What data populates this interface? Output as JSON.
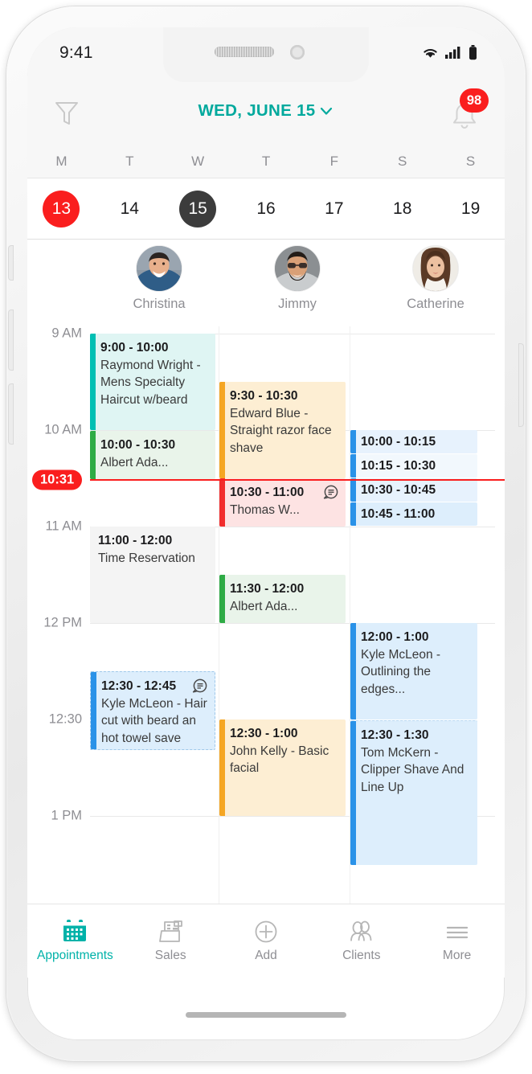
{
  "status_bar": {
    "time": "9:41",
    "wifi_icon": "wifi-icon",
    "cellular_icon": "cellular-signal-icon",
    "battery_icon": "battery-icon"
  },
  "header": {
    "filter_icon": "filter-funnel-icon",
    "date_title": "WED, JUNE 15",
    "chevron_icon": "chevron-down-icon",
    "bell_icon": "notification-bell-icon",
    "badge_count": "98"
  },
  "week": {
    "day_initials": [
      "M",
      "T",
      "W",
      "T",
      "F",
      "S",
      "S"
    ],
    "dates": [
      {
        "num": "13",
        "state": "today"
      },
      {
        "num": "14",
        "state": "normal"
      },
      {
        "num": "15",
        "state": "selected"
      },
      {
        "num": "16",
        "state": "normal"
      },
      {
        "num": "17",
        "state": "normal"
      },
      {
        "num": "18",
        "state": "normal"
      },
      {
        "num": "19",
        "state": "normal"
      }
    ]
  },
  "staff": [
    {
      "name": "Christina",
      "avatar": "avatar-christina"
    },
    {
      "name": "Jimmy",
      "avatar": "avatar-jimmy"
    },
    {
      "name": "Catherine",
      "avatar": "avatar-catherine"
    }
  ],
  "calendar": {
    "time_labels": [
      "9 AM",
      "10 AM",
      "11 AM",
      "12 PM",
      "12:30",
      "1 PM"
    ],
    "now_indicator": {
      "label": "10:31",
      "color": "#fa1e1e"
    },
    "colors": {
      "teal": "#00bfb3",
      "teal_bg": "#dff5f3",
      "green": "#2eab45",
      "green_bg": "#e6f4e8",
      "orange": "#f5a623",
      "orange_bg": "#fdeed3",
      "red": "#f22d2d",
      "red_bg": "#fde3e3",
      "blue": "#2a92e8",
      "blue_bg": "#ddeefc",
      "grey": "#d8d8d8",
      "grey_bg": "#f4f4f4"
    },
    "events": [
      {
        "id": "e1",
        "column": 0,
        "time": "9:00 - 10:00",
        "title": "Raymond Wright - Mens Specialty Haircut w/beard",
        "color": "teal",
        "note": false
      },
      {
        "id": "e2",
        "column": 0,
        "time": "10:00 - 10:30",
        "title": "Albert Ada...",
        "color": "green",
        "note": false
      },
      {
        "id": "e3",
        "column": 1,
        "time": "9:30 - 10:30",
        "title": "Edward Blue  - Straight razor face shave",
        "color": "orange",
        "note": false
      },
      {
        "id": "e4",
        "column": 1,
        "time": "10:30 - 11:00",
        "title": "Thomas W...",
        "color": "red",
        "note": true
      },
      {
        "id": "e5",
        "column": 2,
        "time": "10:00 - 10:15",
        "title": "",
        "color": "blue",
        "note": false
      },
      {
        "id": "e6",
        "column": 2,
        "time": "10:15 - 10:30",
        "title": "",
        "color": "blue",
        "note": false
      },
      {
        "id": "e7",
        "column": 2,
        "time": "10:30 - 10:45",
        "title": "",
        "color": "blue",
        "note": false
      },
      {
        "id": "e8",
        "column": 2,
        "time": "10:45 - 11:00",
        "title": "",
        "color": "blue",
        "note": false
      },
      {
        "id": "e9",
        "column": 0,
        "time": "11:00 - 12:00",
        "title": "Time Reservation",
        "color": "grey",
        "note": false
      },
      {
        "id": "e10",
        "column": 1,
        "time": "11:30 - 12:00",
        "title": "Albert Ada...",
        "color": "green",
        "note": false
      },
      {
        "id": "e11",
        "column": 2,
        "time": "12:00 - 1:00",
        "title": "Kyle McLeon - Outlining the edges...",
        "color": "blue",
        "note": false
      },
      {
        "id": "e12",
        "column": 0,
        "time": "12:30 - 12:45",
        "title": "Kyle McLeon - Hair cut with beard an hot towel save",
        "color": "blue",
        "note": true
      },
      {
        "id": "e13",
        "column": 1,
        "time": "12:30 - 1:00",
        "title": "John Kelly - Basic facial",
        "color": "orange",
        "note": false
      },
      {
        "id": "e14",
        "column": 2,
        "time": "12:30 - 1:30",
        "title": "Tom McKern - Clipper Shave And Line Up",
        "color": "blue",
        "note": false
      }
    ]
  },
  "tabbar": {
    "items": [
      {
        "label": "Appointments",
        "icon": "calendar-icon",
        "active": true
      },
      {
        "label": "Sales",
        "icon": "cash-register-icon",
        "active": false
      },
      {
        "label": "Add",
        "icon": "plus-circle-icon",
        "active": false
      },
      {
        "label": "Clients",
        "icon": "people-icon",
        "active": false
      },
      {
        "label": "More",
        "icon": "hamburger-menu-icon",
        "active": false
      }
    ]
  }
}
